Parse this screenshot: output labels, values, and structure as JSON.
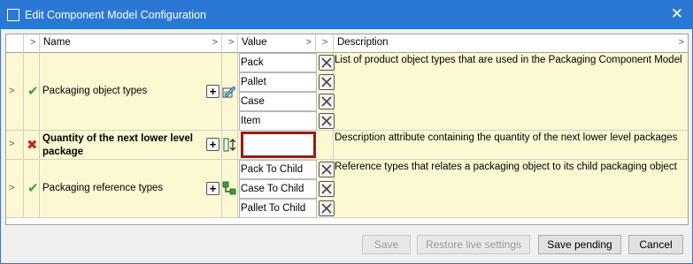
{
  "window": {
    "title": "Edit Component Model Configuration",
    "close": "✕"
  },
  "headers": {
    "arrow": ">",
    "name": "Name",
    "value": "Value",
    "description": "Description"
  },
  "rows": [
    {
      "status": "valid",
      "name": "Packaging object types",
      "values": [
        "Pack",
        "Pallet",
        "Case",
        "Item"
      ],
      "description": "List of product object types that are used in the Packaging Component Model"
    },
    {
      "status": "invalid",
      "name": "Quantity of the next lower level package",
      "values": [
        ""
      ],
      "description": "Description attribute containing the quantity of the next lower level packages"
    },
    {
      "status": "valid",
      "name": "Packaging reference types",
      "values": [
        "Pack To Child",
        "Case To Child",
        "Pallet To Child"
      ],
      "description": "Reference types that relates a packaging object to its child packaging object"
    }
  ],
  "buttons": {
    "save": "Save",
    "restore": "Restore live settings",
    "save_pending": "Save pending",
    "cancel": "Cancel"
  },
  "colors": {
    "titlebar": "#2b78d4",
    "row_bg": "#fcf8d2",
    "valid": "#3aa335",
    "invalid": "#c8281e",
    "error_border": "#9b1a1a"
  }
}
